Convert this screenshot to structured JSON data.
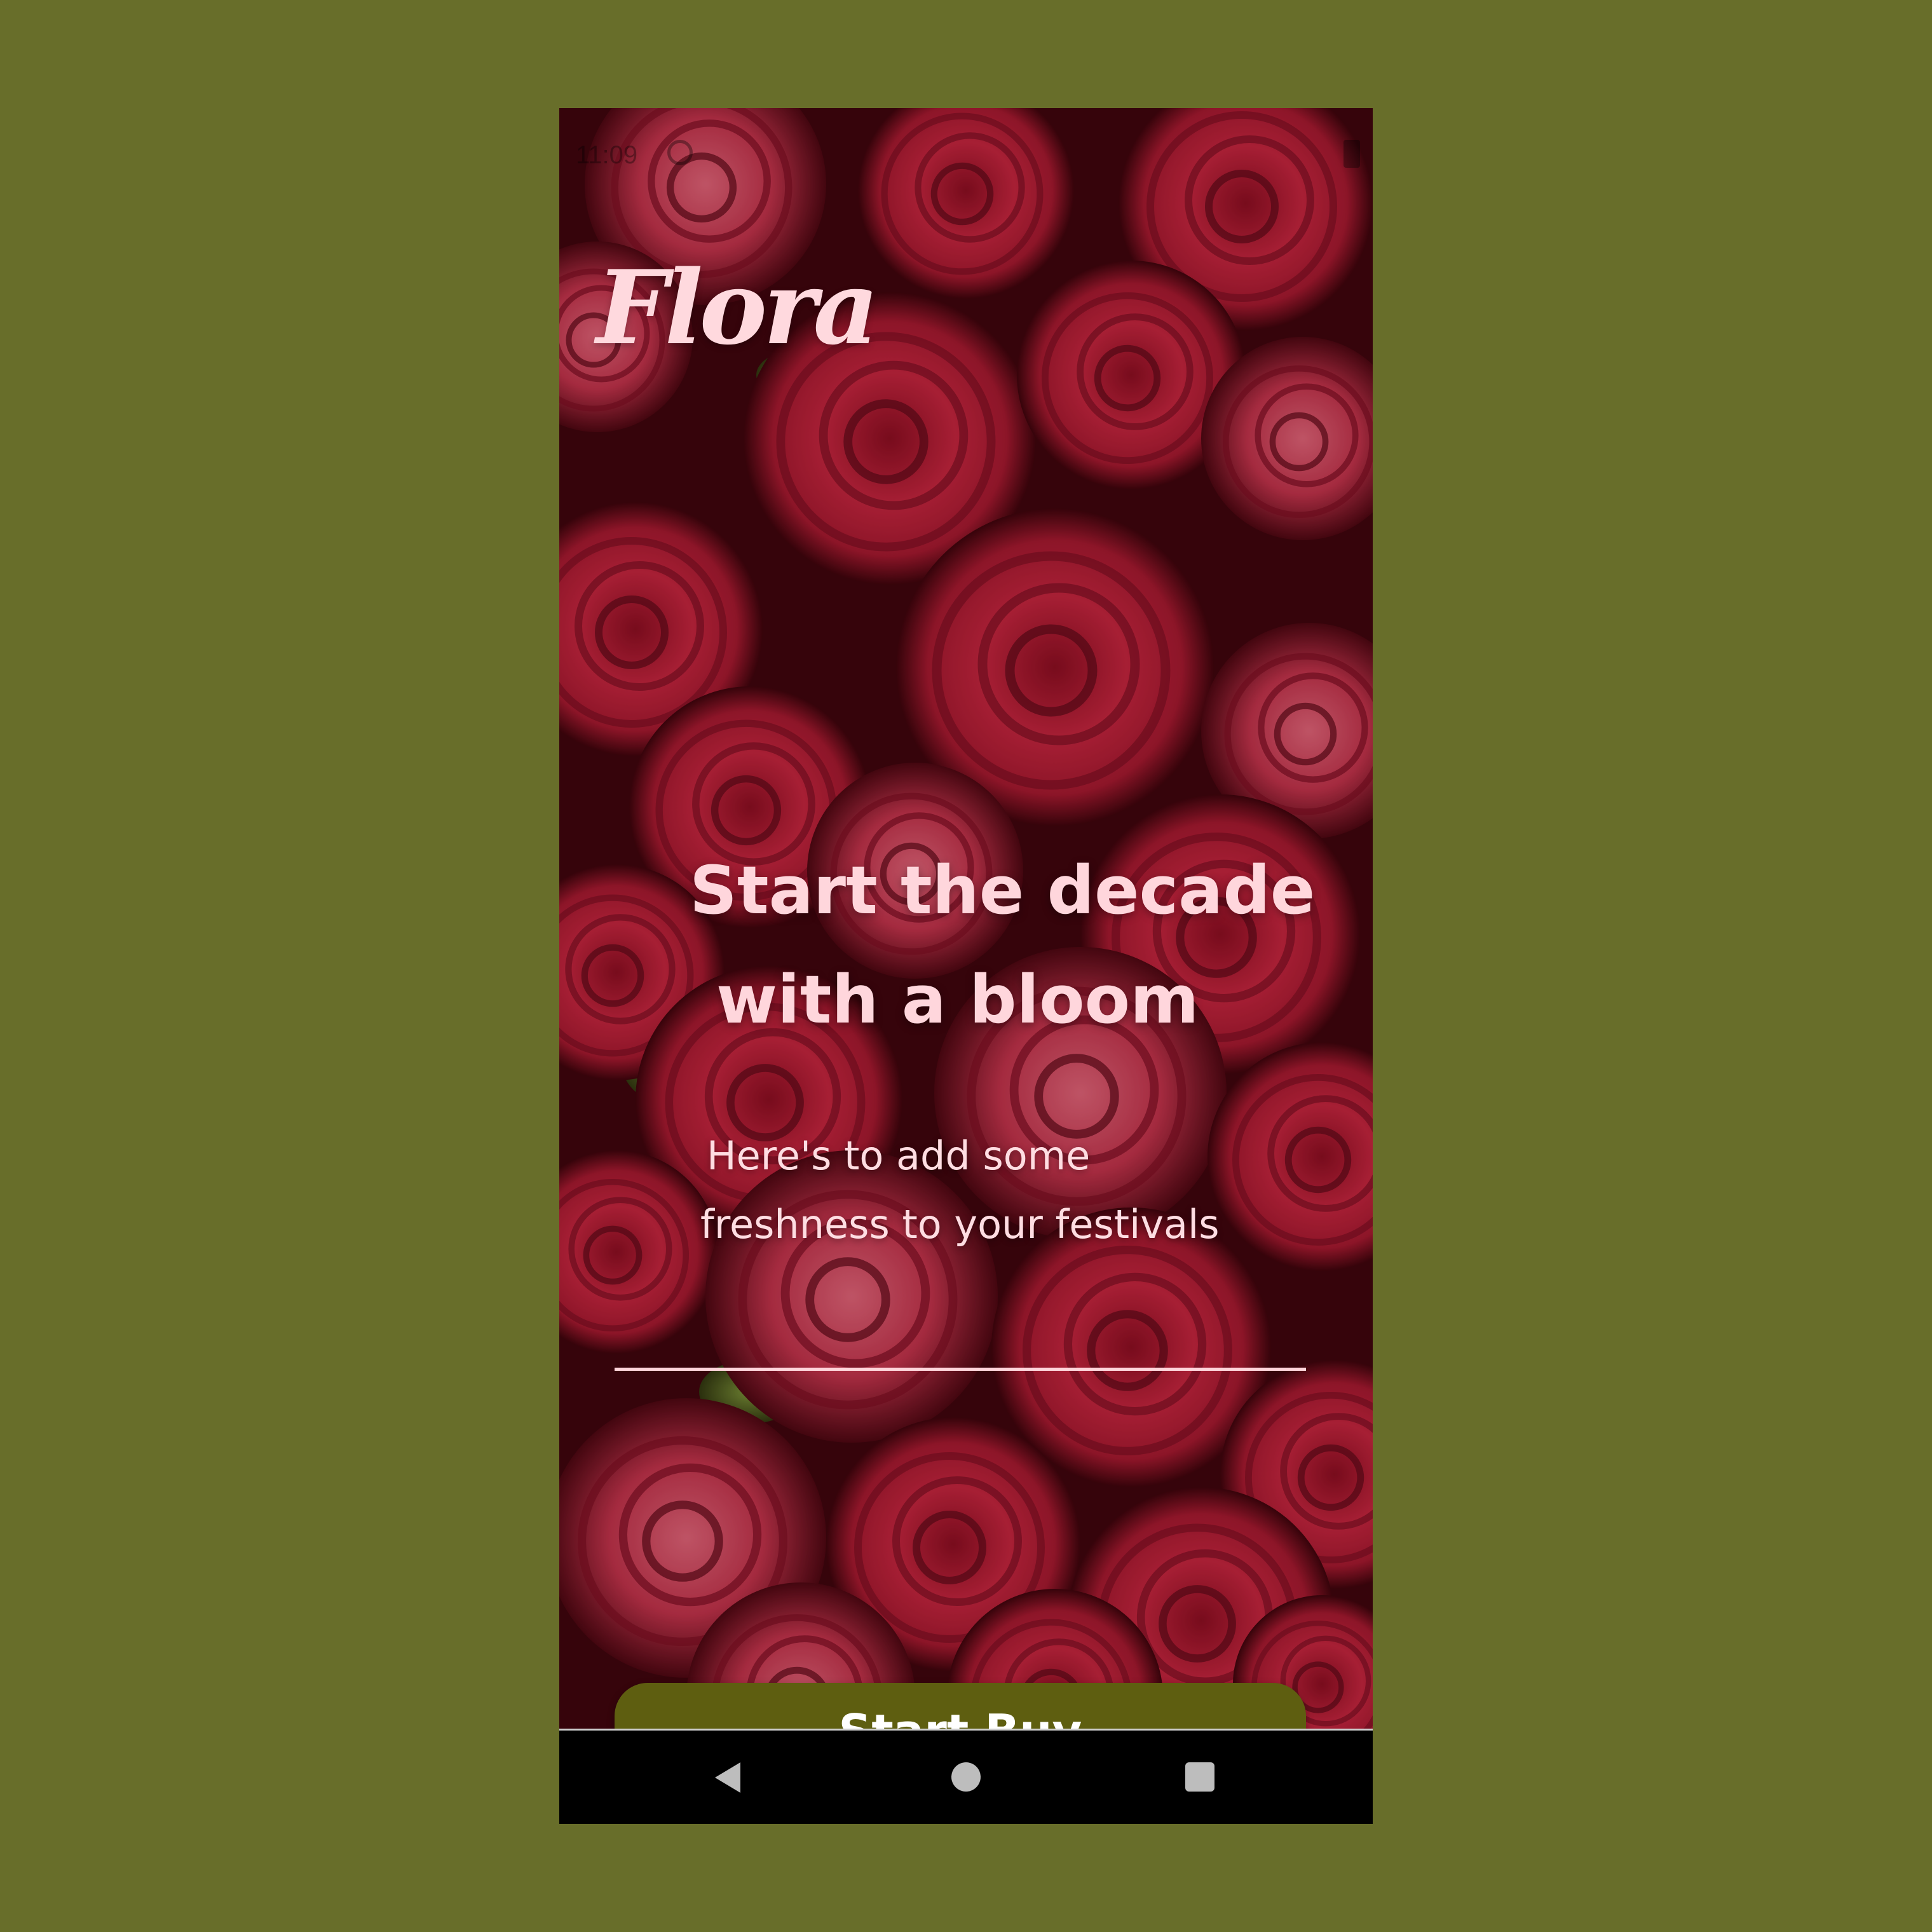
{
  "status_bar": {
    "time": "11:09"
  },
  "app": {
    "logo_text": "Flora"
  },
  "hero": {
    "headline_line1": "Start the decade",
    "headline_line2": "with a bloom",
    "subtext_line1": "Here's to add some",
    "subtext_line2": "freshness to your festivals"
  },
  "cta": {
    "label": "Start Buy"
  },
  "nav": {
    "back": "back-icon",
    "home": "home-icon",
    "recents": "recents-icon"
  },
  "colors": {
    "page_background": "#686e2a",
    "text_pink": "#ffd6dc",
    "button_olive": "#5e5e10",
    "button_text": "#ffffff"
  }
}
